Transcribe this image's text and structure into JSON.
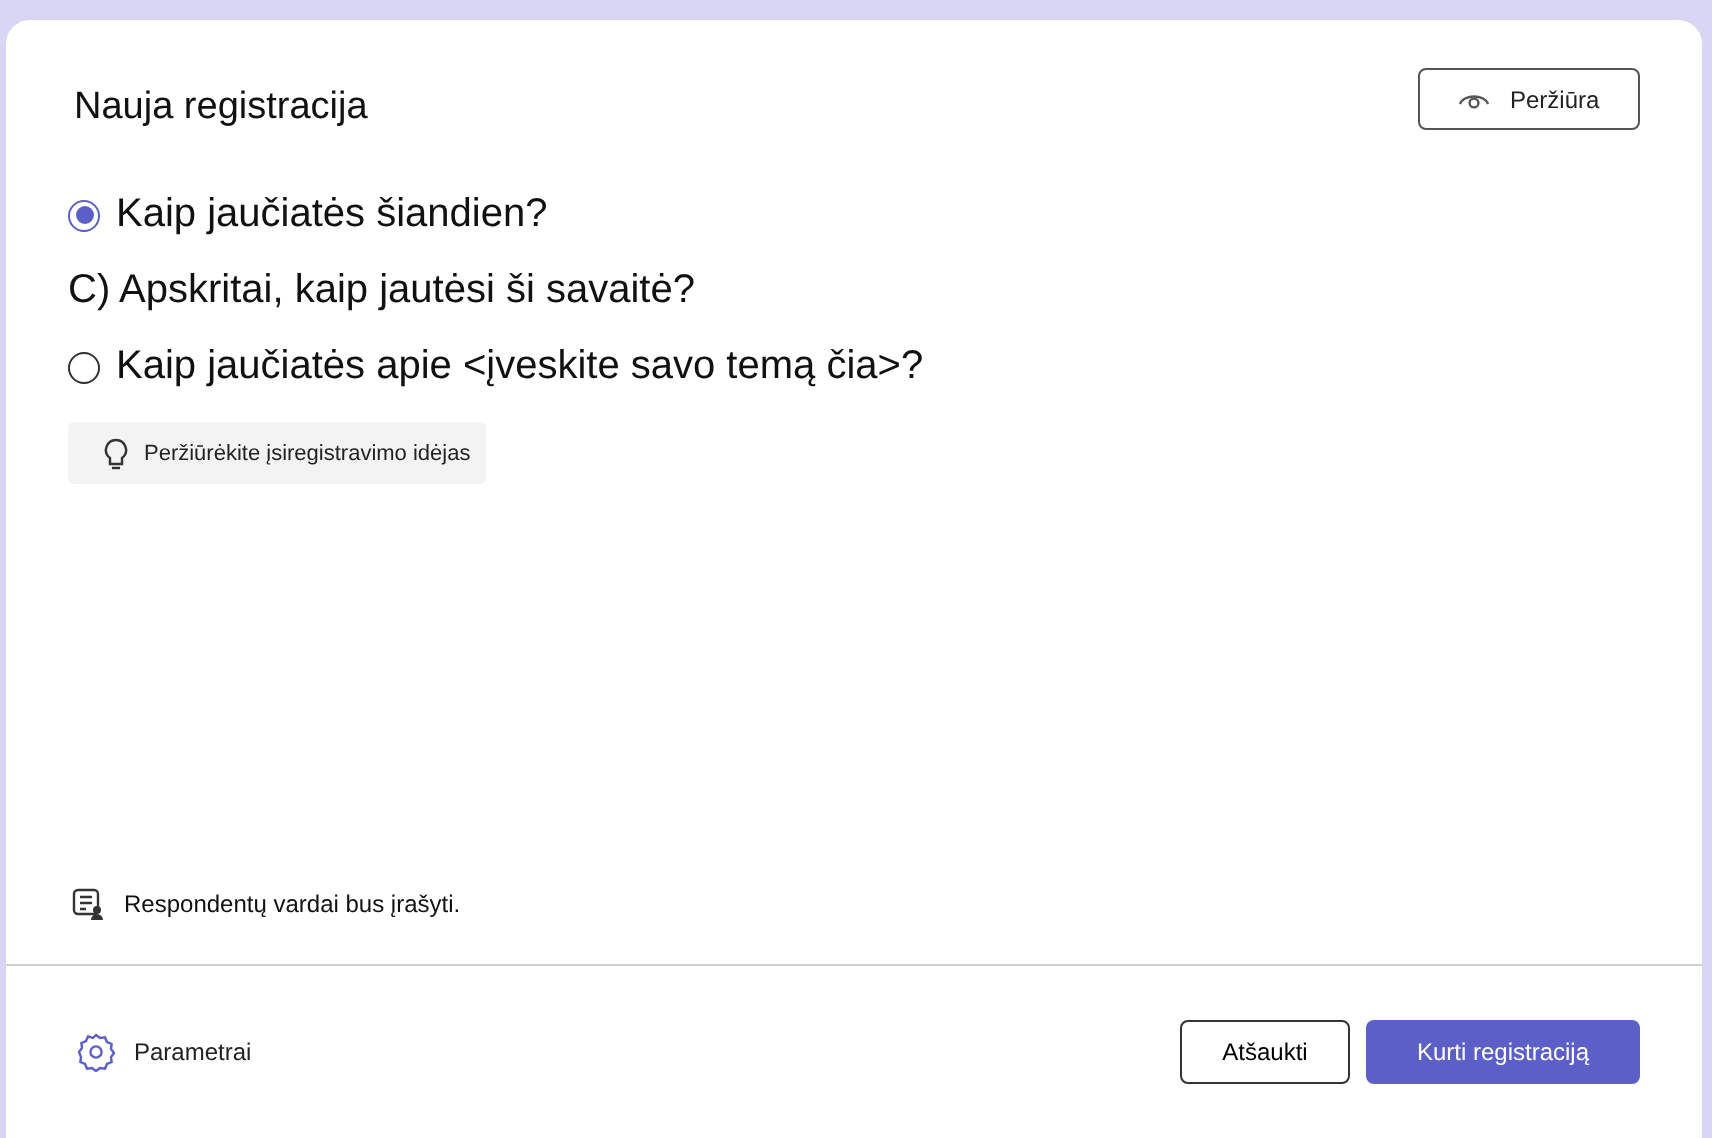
{
  "dialog": {
    "title": "Nauja registracija",
    "preview_button": "Peržiūra"
  },
  "options": [
    {
      "kind": "radio",
      "label": "Kaip jaučiatės šiandien?",
      "selected": true
    },
    {
      "kind": "plain",
      "label": "C) Apskritai, kaip jautėsi ši savaitė?"
    },
    {
      "kind": "radio",
      "label": "Kaip jaučiatės apie <įveskite savo temą čia>?",
      "selected": false
    }
  ],
  "ideas_button": "Peržiūrėkite įsiregistravimo idėjas",
  "note": "Respondentų vardai bus įrašyti.",
  "footer": {
    "settings": "Parametrai",
    "cancel_button": "Atšaukti",
    "create_button": "Kurti registraciją"
  }
}
